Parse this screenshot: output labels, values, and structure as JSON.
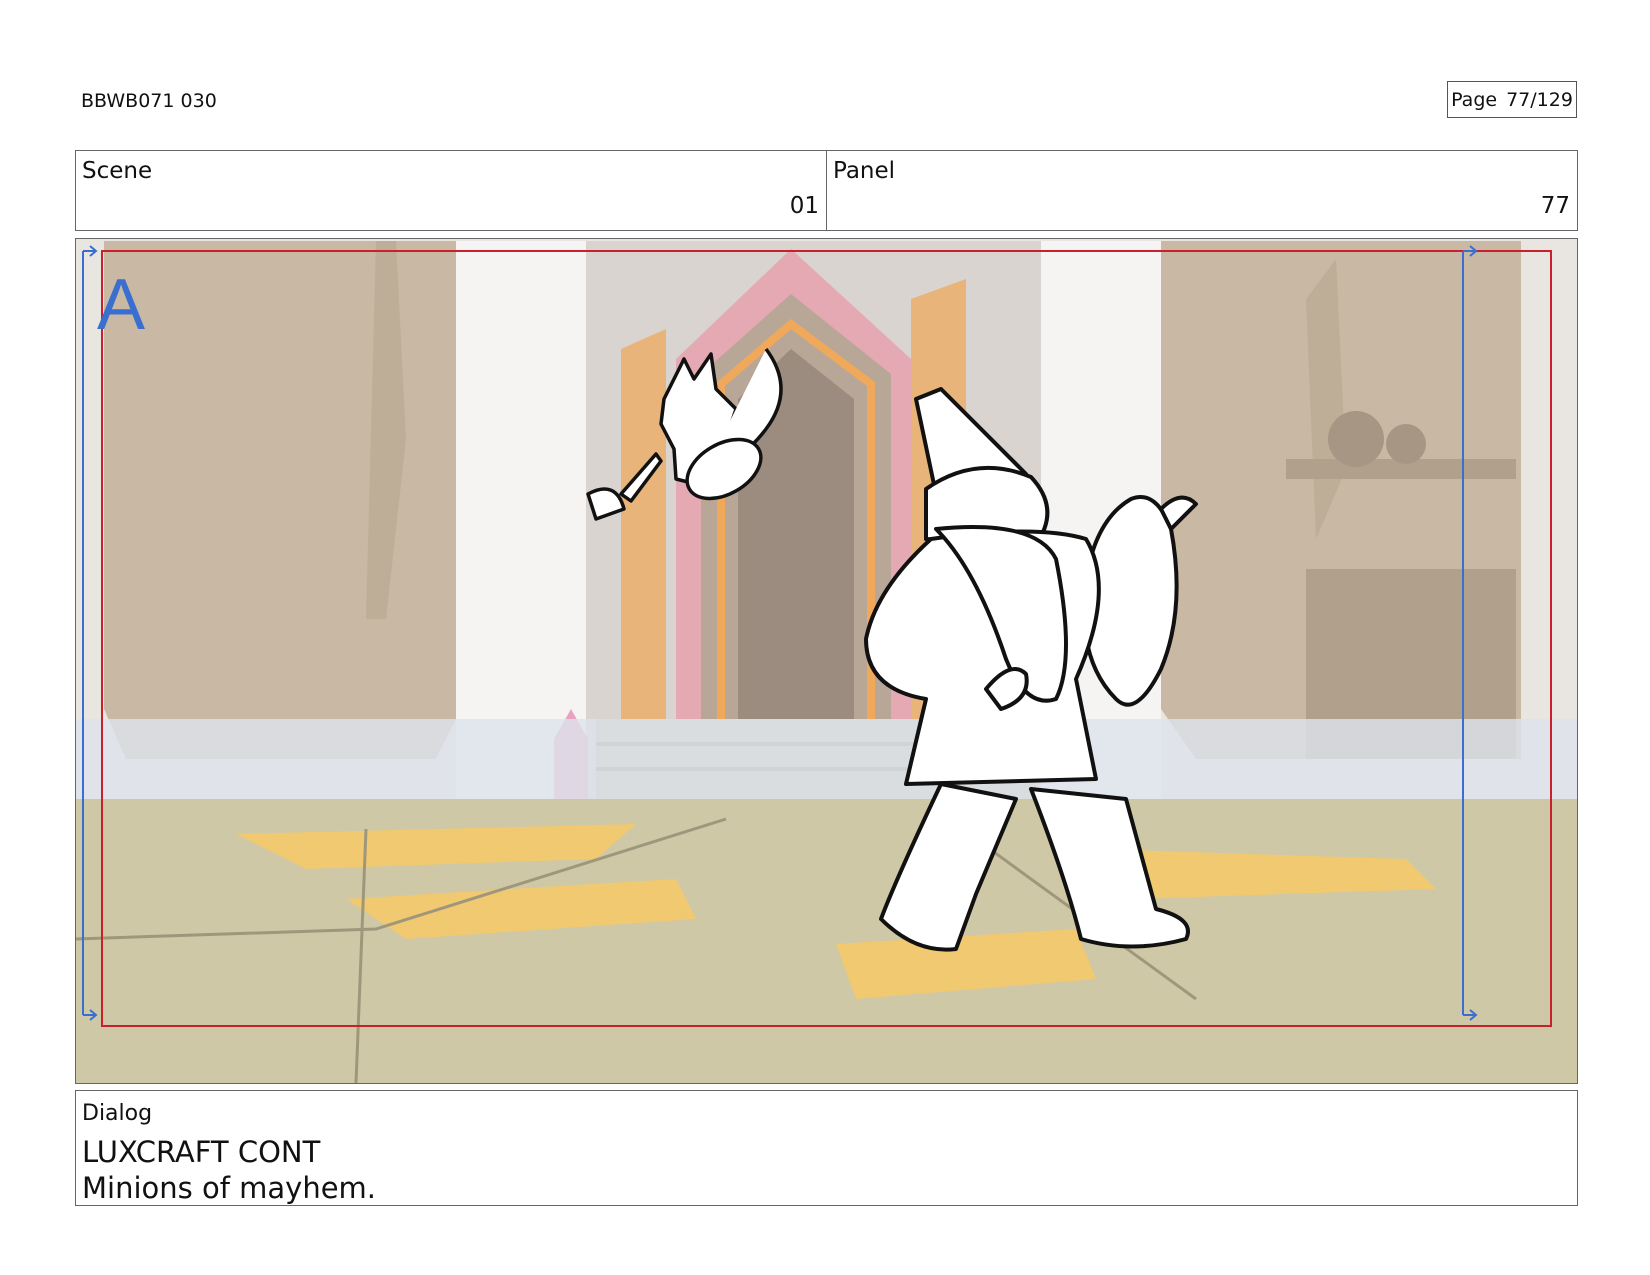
{
  "header": {
    "doc_id": "BBWB071 030",
    "page_label": "Page",
    "page_value": "77/129"
  },
  "info": {
    "scene_label": "Scene",
    "scene_value": "01",
    "panel_label": "Panel",
    "panel_value": "77"
  },
  "panel": {
    "letter": "A"
  },
  "dialog": {
    "label": "Dialog",
    "speaker": "LUXCRAFT CONT",
    "line": "Minions of mayhem."
  },
  "colors": {
    "frame_red": "#c8202c",
    "frame_blue": "#3a6fcf",
    "wall": "#c9b8a4",
    "floor": "#cfc8a6",
    "floor_highlight": "#f3c96a"
  }
}
